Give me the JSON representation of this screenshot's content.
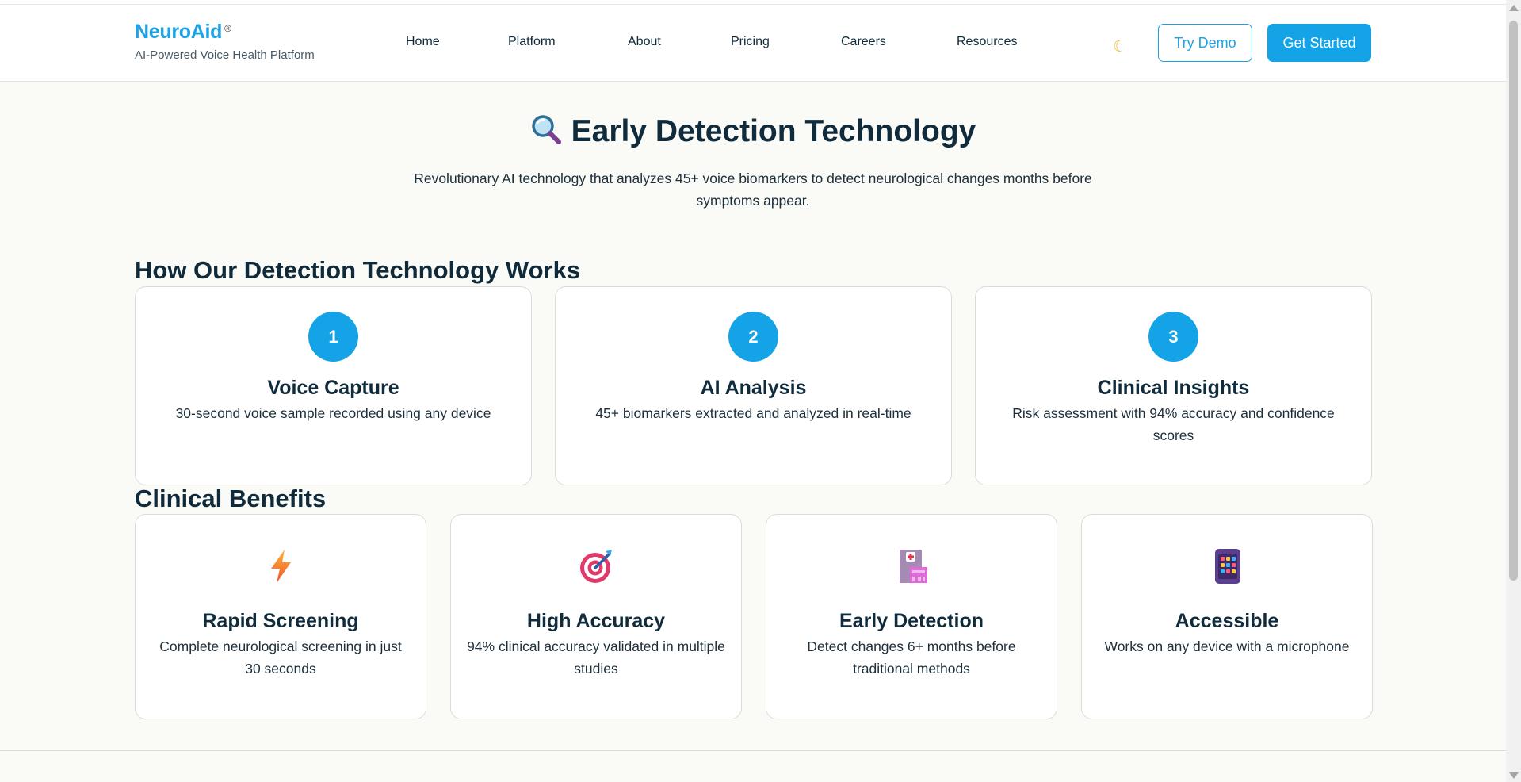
{
  "brand": {
    "name": "NeuroAid",
    "mark": "®",
    "tagline": "AI-Powered Voice Health Platform"
  },
  "nav": [
    "Home",
    "Platform",
    "About",
    "Pricing",
    "Careers",
    "Resources"
  ],
  "header": {
    "theme_icon": "☾",
    "try_demo": "Try Demo",
    "get_started": "Get Started"
  },
  "hero": {
    "title": "Early Detection Technology",
    "icon": "magnifying-glass-icon",
    "subtitle": "Revolutionary AI technology that analyzes 45+ voice biomarkers to detect neurological changes months before symptoms appear."
  },
  "how": {
    "title": "How Our Detection Technology Works",
    "steps": [
      {
        "number": "1",
        "title": "Voice Capture",
        "desc": "30-second voice sample recorded using any device"
      },
      {
        "number": "2",
        "title": "AI Analysis",
        "desc": "45+ biomarkers extracted and analyzed in real-time"
      },
      {
        "number": "3",
        "title": "Clinical Insights",
        "desc": "Risk assessment with 94% accuracy and confidence scores"
      }
    ]
  },
  "benefits": {
    "title": "Clinical Benefits",
    "items": [
      {
        "icon": "lightning-icon",
        "title": "Rapid Screening",
        "desc": "Complete neurological screening in just 30 seconds"
      },
      {
        "icon": "target-icon",
        "title": "High Accuracy",
        "desc": "94% clinical accuracy validated in multiple studies"
      },
      {
        "icon": "hospital-icon",
        "title": "Early Detection",
        "desc": "Detect changes 6+ months before traditional methods"
      },
      {
        "icon": "mobile-phone-icon",
        "title": "Accessible",
        "desc": "Works on any device with a microphone"
      }
    ]
  },
  "colors": {
    "accent": "#14a3e6",
    "text": "#102c3c",
    "background": "#fafaf7"
  }
}
